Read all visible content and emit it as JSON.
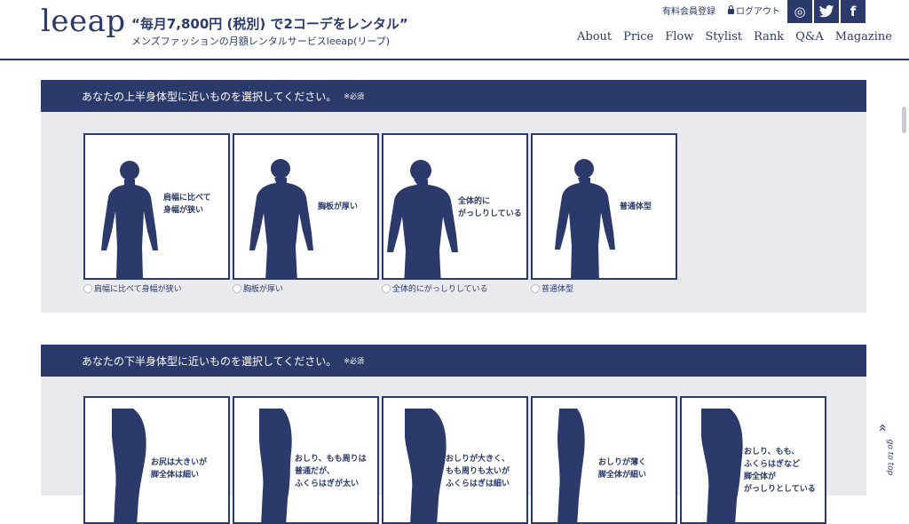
{
  "header": {
    "logo": "leeap",
    "tagline": "“毎月7,800円 (税別) で2コーデをレンタル”",
    "subline": "メンズファッションの月額レンタルサービスleeap(リープ)",
    "top_links": [
      "有料会員登録",
      "ログアウト"
    ],
    "social": [
      {
        "icon": "instagram-icon",
        "glyph": "◎"
      },
      {
        "icon": "twitter-icon",
        "glyph": "🐦"
      },
      {
        "icon": "facebook-icon",
        "glyph": "f"
      }
    ],
    "nav": [
      "About",
      "Price",
      "Flow",
      "Stylist",
      "Rank",
      "Q&A",
      "Magazine"
    ]
  },
  "upper": {
    "title": "あなたの上半身体型に近いものを選択してください。",
    "required": "※必須",
    "options": [
      {
        "card_text": "肩幅に比べて\n身幅が狭い",
        "radio": "肩幅に比べて身幅が狭い",
        "build": "narrow"
      },
      {
        "card_text": "胸板が厚い",
        "radio": "胸板が厚い",
        "build": "chest"
      },
      {
        "card_text": "全体的に\nがっしりしている",
        "radio": "全体的にがっしりしている",
        "build": "broad"
      },
      {
        "card_text": "普通体型",
        "radio": "普通体型",
        "build": "normal"
      }
    ]
  },
  "lower": {
    "title": "あなたの下半身体型に近いものを選択してください。",
    "required": "※必須",
    "options": [
      {
        "card_text": "お尻は大きいが\n脚全体は細い"
      },
      {
        "card_text": "おしり、もも周りは\n普通だが、\nふくらはぎが太い"
      },
      {
        "card_text": "おしりが大きく、\nもも周りも太いが\nふくらはぎは細い"
      },
      {
        "card_text": "おしりが薄く\n脚全体が細い"
      },
      {
        "card_text": "おしり、もも、\nふくらはぎなど\n脚全体が\nがっしりとしている"
      }
    ]
  },
  "go_to_top": "go to top",
  "colors": {
    "navy": "#2b3a6b",
    "panel": "#e9eaee"
  }
}
